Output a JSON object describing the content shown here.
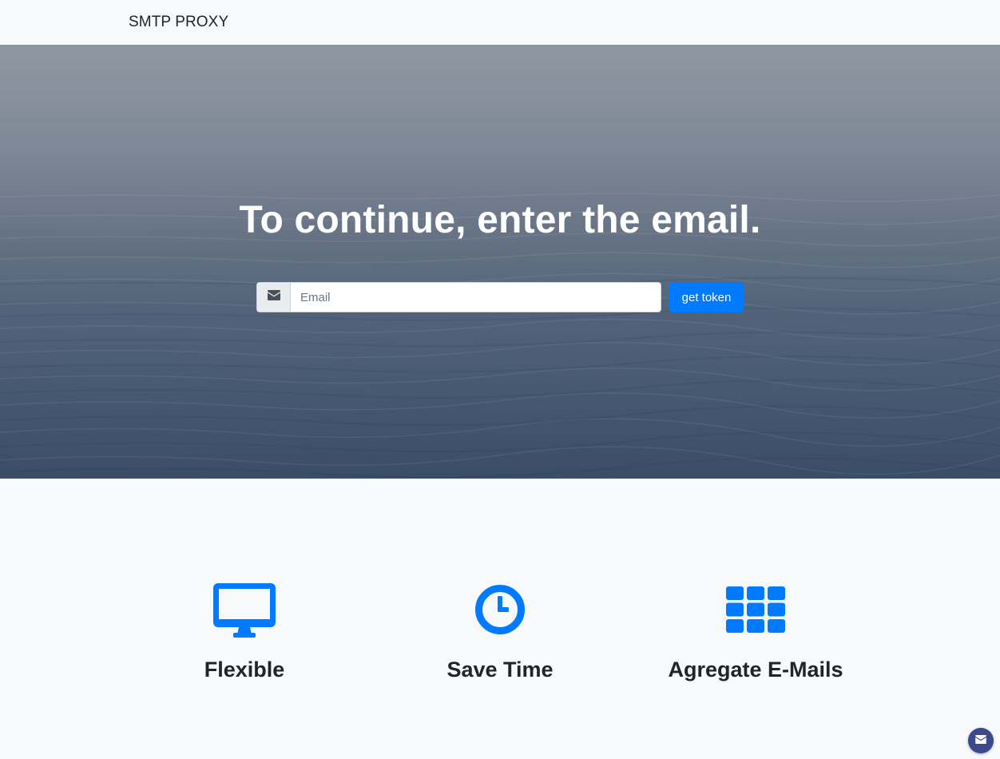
{
  "navbar": {
    "brand": "SMTP PROXY"
  },
  "hero": {
    "title": "To continue, enter the email.",
    "email_input": {
      "placeholder": "Email",
      "value": "",
      "icon": "envelope-icon"
    },
    "submit_label": "get token"
  },
  "features": [
    {
      "icon": "desktop-icon",
      "title": "Flexible"
    },
    {
      "icon": "clock-icon",
      "title": "Save Time"
    },
    {
      "icon": "grid-icon",
      "title": "Agregate E-Mails"
    }
  ],
  "floating_button": {
    "icon": "envelope-icon"
  },
  "colors": {
    "accent": "#007bff",
    "nav_background": "#f8f9fa",
    "text": "#212529",
    "fab": "#3b4a8a"
  }
}
